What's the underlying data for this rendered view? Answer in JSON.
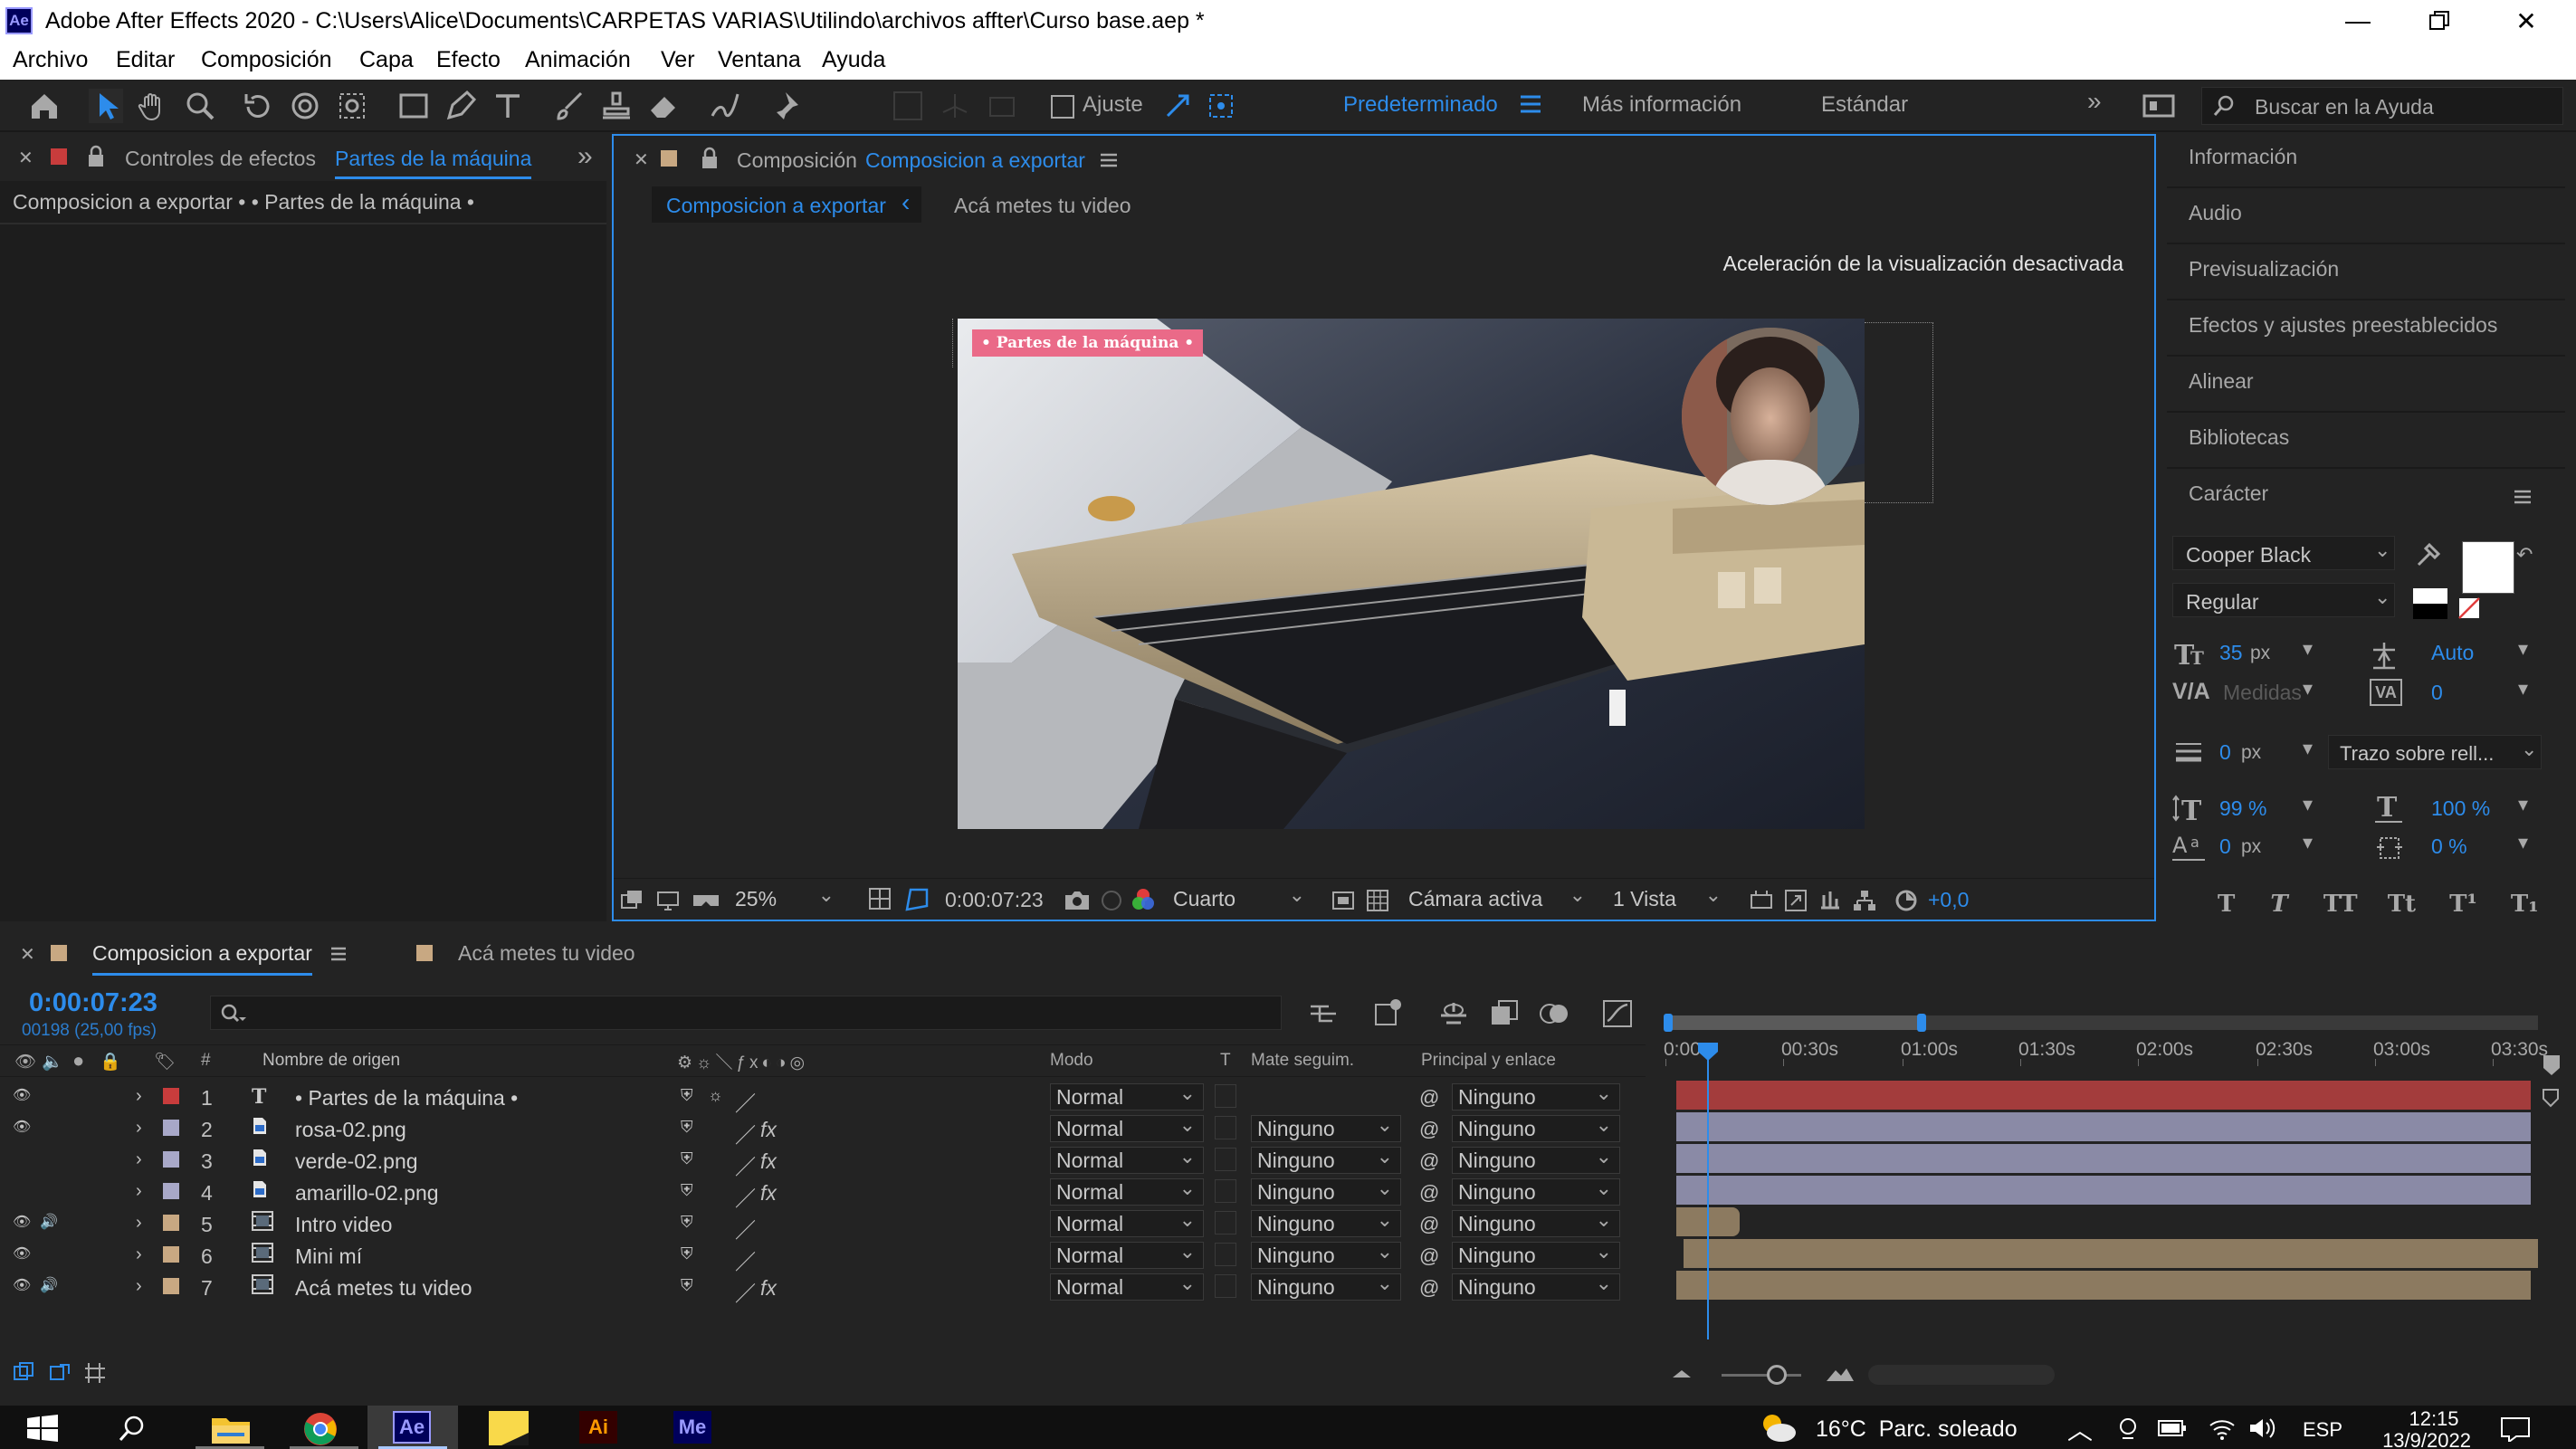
{
  "window": {
    "title": "Adobe After Effects 2020 - C:\\Users\\Alice\\Documents\\CARPETAS VARIAS\\Utilindo\\archivos affter\\Curso base.aep *",
    "app_logo": "Ae"
  },
  "menu": [
    "Archivo",
    "Editar",
    "Composición",
    "Capa",
    "Efecto",
    "Animación",
    "Ver",
    "Ventana",
    "Ayuda"
  ],
  "toolbar": {
    "snap_label": "Ajuste",
    "workspaces": [
      "Predeterminado",
      "Más información",
      "Estándar"
    ],
    "search_placeholder": "Buscar en la Ayuda",
    "icons": [
      "home-icon",
      "selection-tool-icon",
      "hand-tool-icon",
      "zoom-tool-icon",
      "rotate-tool-icon",
      "orbit-camera-icon",
      "pan-behind-icon",
      "rectangle-tool-icon",
      "pen-tool-icon",
      "type-tool-icon",
      "brush-tool-icon",
      "clone-stamp-icon",
      "eraser-icon",
      "roto-brush-icon",
      "puppet-pin-icon"
    ]
  },
  "effects_panel": {
    "tab_prefix": "Controles de efectos",
    "tab_layer": "Partes de la máquina",
    "breadcrumb": "Composicion a exportar • • Partes de la máquina •",
    "label_color": "#c83c3c"
  },
  "comp_panel": {
    "tab_prefix": "Composición",
    "tab_name": "Composicion a exportar",
    "subtab_active": "Composicion a exportar",
    "subtab_other": "Acá metes tu video",
    "notice": "Aceleración de la visualización desactivada",
    "overlay_label": "• Partes de la máquina •",
    "zoom": "25%",
    "timecode": "0:00:07:23",
    "resolution": "Cuarto",
    "camera": "Cámara activa",
    "views": "1 Vista",
    "exposure": "+0,0"
  },
  "right_panel": {
    "sections": [
      "Información",
      "Audio",
      "Previsualización",
      "Efectos y ajustes preestablecidos",
      "Alinear",
      "Bibliotecas",
      "Carácter"
    ],
    "character": {
      "font": "Cooper Black",
      "style": "Regular",
      "size": "35",
      "size_unit": "px",
      "leading": "Auto",
      "kerning": "Medidas",
      "tracking": "0",
      "stroke": "0",
      "stroke_unit": "px",
      "stroke_mode": "Trazo sobre rell...",
      "vscale": "99 %",
      "hscale": "100 %",
      "baseline": "0",
      "baseline_unit": "px",
      "tsume": "0 %",
      "fill_color": "#ffffff"
    }
  },
  "timeline": {
    "tab_active": "Composicion a exportar",
    "tab_other": "Acá metes tu video",
    "timecode": "0:00:07:23",
    "frame_info": "00198 (25,00 fps)",
    "headers": {
      "num": "#",
      "source": "Nombre de origen",
      "mode": "Modo",
      "t": "T",
      "matte": "Mate seguim.",
      "parent": "Principal y enlace"
    },
    "ruler": [
      "0:00s",
      "00:30s",
      "01:00s",
      "01:30s",
      "02:00s",
      "02:30s",
      "03:00s",
      "03:30s"
    ],
    "layers": [
      {
        "num": "1",
        "name": "• Partes de la máquina •",
        "type": "text",
        "color": "#c83c3c",
        "mode": "Normal",
        "matte": "",
        "parent": "Ninguno",
        "eye": true,
        "audio": false,
        "fx": false,
        "bar_color": "#a33c3c"
      },
      {
        "num": "2",
        "name": "rosa-02.png",
        "type": "image",
        "color": "#a8a8c8",
        "mode": "Normal",
        "matte": "Ninguno",
        "parent": "Ninguno",
        "eye": true,
        "audio": false,
        "fx": true,
        "bar_color": "#8a8aa6"
      },
      {
        "num": "3",
        "name": "verde-02.png",
        "type": "image",
        "color": "#a8a8c8",
        "mode": "Normal",
        "matte": "Ninguno",
        "parent": "Ninguno",
        "eye": false,
        "audio": false,
        "fx": true,
        "bar_color": "#8a8aa6"
      },
      {
        "num": "4",
        "name": "amarillo-02.png",
        "type": "image",
        "color": "#a8a8c8",
        "mode": "Normal",
        "matte": "Ninguno",
        "parent": "Ninguno",
        "eye": false,
        "audio": false,
        "fx": true,
        "bar_color": "#8a8aa6"
      },
      {
        "num": "5",
        "name": "Intro video",
        "type": "comp",
        "color": "#c8a882",
        "mode": "Normal",
        "matte": "Ninguno",
        "parent": "Ninguno",
        "eye": true,
        "audio": true,
        "fx": false,
        "bar_color": "#8c7a60"
      },
      {
        "num": "6",
        "name": "Mini mí",
        "type": "comp",
        "color": "#c8a882",
        "mode": "Normal",
        "matte": "Ninguno",
        "parent": "Ninguno",
        "eye": true,
        "audio": false,
        "fx": false,
        "bar_color": "#8c7a60"
      },
      {
        "num": "7",
        "name": "Acá metes tu video",
        "type": "comp",
        "color": "#c8a882",
        "mode": "Normal",
        "matte": "Ninguno",
        "parent": "Ninguno",
        "eye": true,
        "audio": true,
        "fx": true,
        "bar_color": "#8c7a60"
      }
    ]
  },
  "taskbar": {
    "weather": "16°C  Parc. soleado",
    "lang": "ESP",
    "time": "12:15",
    "date": "13/9/2022",
    "apps": [
      "Ae",
      "Ai",
      "Me"
    ]
  }
}
